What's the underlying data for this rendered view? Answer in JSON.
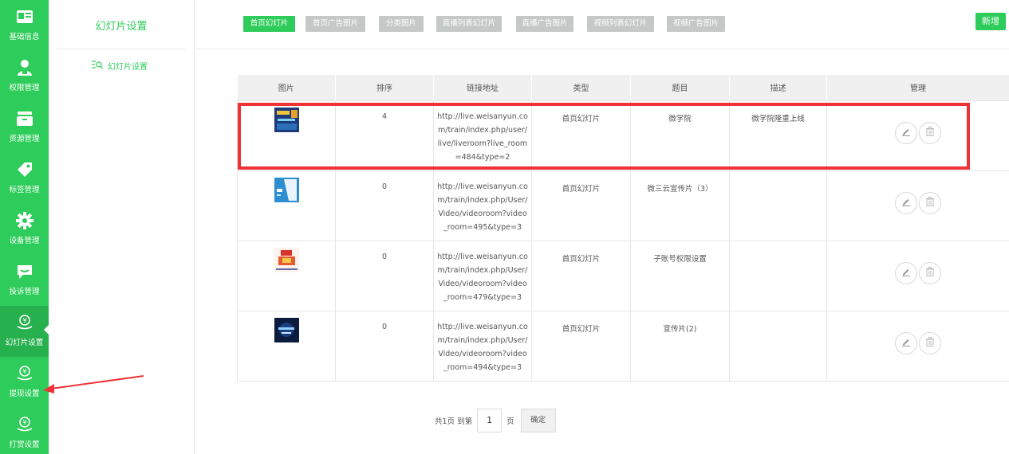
{
  "rail": {
    "items": [
      {
        "label": "基础信息",
        "icon": "id-card-icon"
      },
      {
        "label": "权限管理",
        "icon": "user-lock-icon"
      },
      {
        "label": "资源管理",
        "icon": "inbox-icon"
      },
      {
        "label": "标签管理",
        "icon": "tag-icon"
      },
      {
        "label": "设备管理",
        "icon": "gear-icon"
      },
      {
        "label": "投诉管理",
        "icon": "chat-bubble-icon"
      },
      {
        "label": "幻灯片设置",
        "icon": "yen-hand-icon"
      },
      {
        "label": "提现设置",
        "icon": "yen-hand-icon"
      },
      {
        "label": "打赏设置",
        "icon": "yen-hand-icon"
      }
    ],
    "active_index": 6
  },
  "subnav": {
    "title": "幻灯片设置",
    "item_label": "幻灯片设置"
  },
  "tabs": [
    {
      "label": "首页幻灯片",
      "active": true
    },
    {
      "label": "首页广告图片",
      "active": false
    },
    {
      "label": "分类图片",
      "active": false
    },
    {
      "label": "直播列表幻灯片",
      "active": false
    },
    {
      "label": "直播广告图片",
      "active": false
    },
    {
      "label": "视频列表幻灯片",
      "active": false
    },
    {
      "label": "视频广告图片",
      "active": false
    }
  ],
  "new_button": "新增",
  "table": {
    "headers": [
      "图片",
      "排序",
      "链接地址",
      "类型",
      "题目",
      "描述",
      "管理"
    ],
    "rows": [
      {
        "order": "4",
        "link": "http://live.weisanyun.com/train/index.php/user/live/liveroom?live_room=484&type=2",
        "type": "首页幻灯片",
        "title": "微学院",
        "desc": "微学院隆重上线"
      },
      {
        "order": "0",
        "link": "http://live.weisanyun.com/train/index.php/User/Video/videoroom?video_room=495&type=3",
        "type": "首页幻灯片",
        "title": "微三云宣传片（3）",
        "desc": ""
      },
      {
        "order": "0",
        "link": "http://live.weisanyun.com/train/index.php/User/Video/videoroom?video_room=479&type=3",
        "type": "首页幻灯片",
        "title": "子账号权限设置",
        "desc": ""
      },
      {
        "order": "0",
        "link": "http://live.weisanyun.com/train/index.php/User/Video/videoroom?video_room=494&type=3",
        "type": "首页幻灯片",
        "title": "宣传片(2)",
        "desc": ""
      }
    ]
  },
  "pager": {
    "prefix": "共1页 到第",
    "page": "1",
    "suffix": "页",
    "confirm": "确定"
  },
  "colors": {
    "accent": "#2ecc5a",
    "highlight": "#ee3338"
  }
}
